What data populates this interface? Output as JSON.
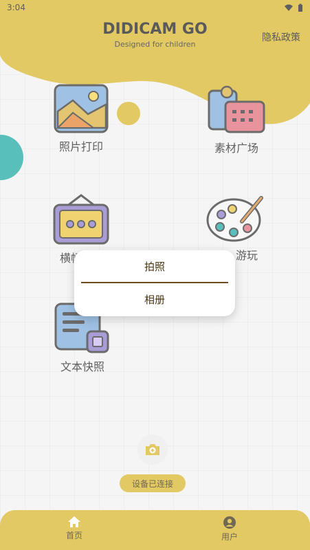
{
  "status_bar": {
    "time": "3:04"
  },
  "header": {
    "title": "DIDICAM GO",
    "subtitle": "Designed for children",
    "privacy_label": "隐私政策"
  },
  "tiles": {
    "photo_print": {
      "label": "照片打印",
      "icon": "picture-frame-icon"
    },
    "materials": {
      "label": "素材广场",
      "icon": "notes-calendar-icon"
    },
    "banner": {
      "label": "横幅",
      "icon": "signboard-icon"
    },
    "play": {
      "label": "游玩",
      "icon": "paint-palette-icon"
    },
    "text_snap": {
      "label": "文本快照",
      "icon": "document-icon"
    }
  },
  "camera_button": {
    "icon": "camera-add-icon"
  },
  "device_status": {
    "label": "设备已连接"
  },
  "bottom_nav": {
    "home_label": "首页",
    "user_label": "用户"
  },
  "dialog": {
    "take_photo": "拍照",
    "album": "相册"
  },
  "colors": {
    "brand_yellow": "#d7b428",
    "teal": "#1aa7a0",
    "dialog_divider": "#6b4a1e"
  }
}
